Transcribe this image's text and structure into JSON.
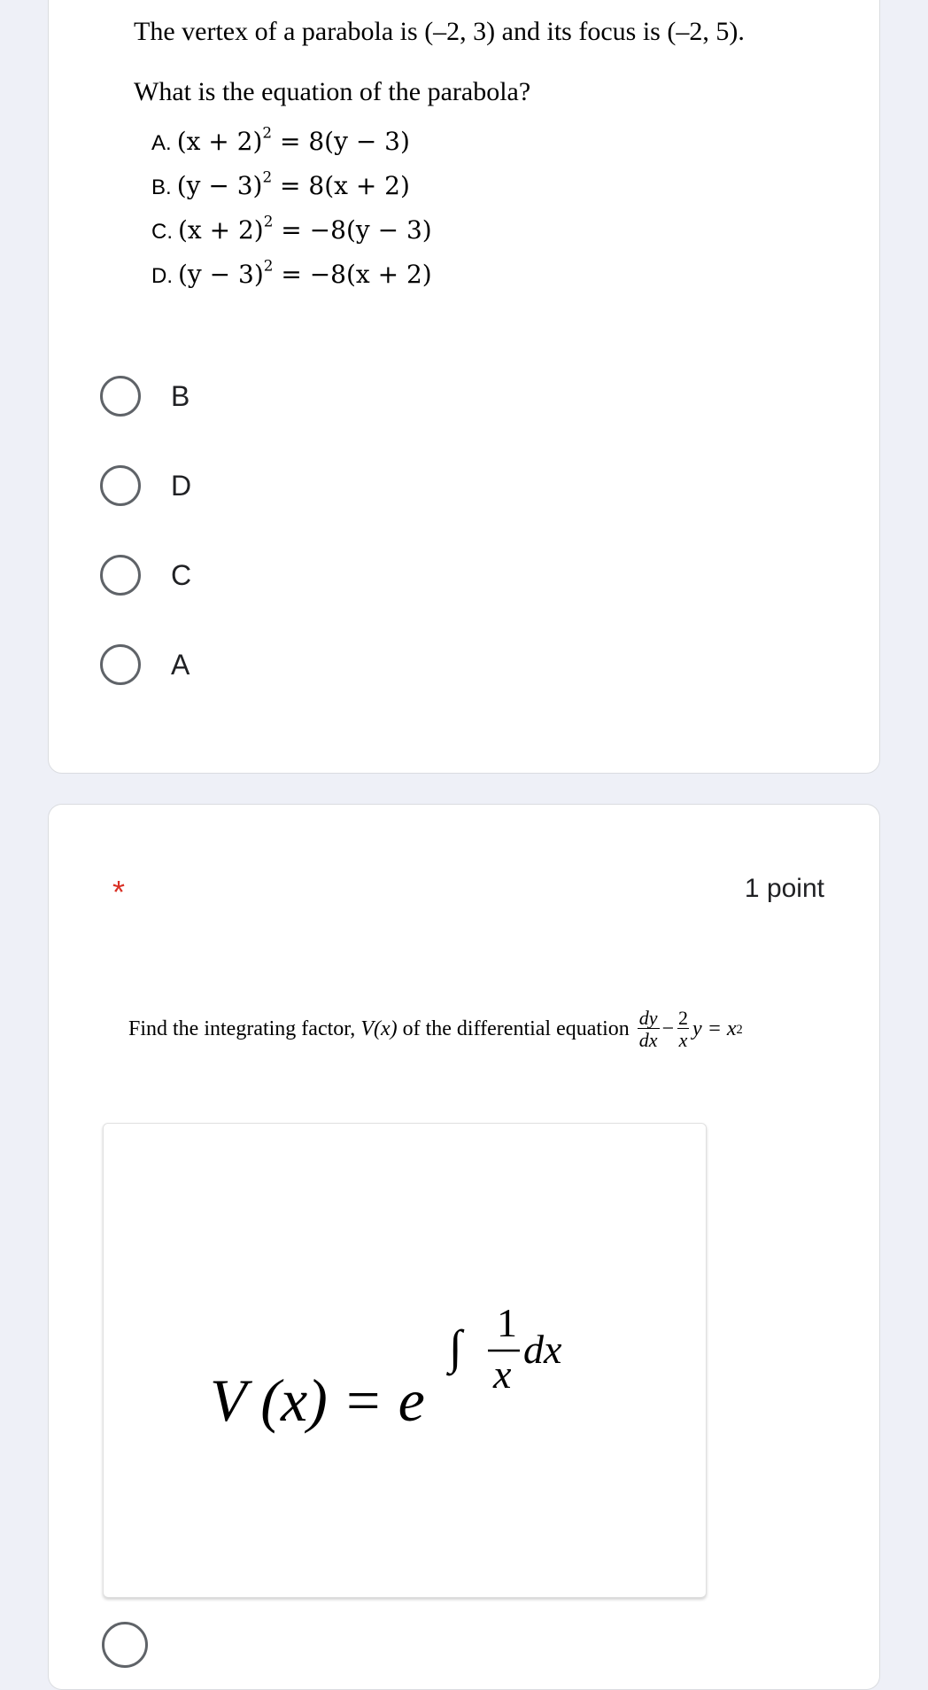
{
  "question1": {
    "line1_prefix": "The vertex of a parabola is",
    "vertex": "(–2, 3)",
    "line1_middle": "and its focus is",
    "focus": "(–2, 5)",
    "line1_suffix": ".",
    "line2": "What is the equation of the parabola?",
    "statement_options": [
      {
        "letter": "A.",
        "lhs_base": "(x + 2)",
        "rhs": " = 8(y − 3)"
      },
      {
        "letter": "B.",
        "lhs_base": "(y − 3)",
        "rhs": " = 8(x + 2)"
      },
      {
        "letter": "C.",
        "lhs_base": "(x + 2)",
        "rhs": " = −8(y − 3)"
      },
      {
        "letter": "D.",
        "lhs_base": "(y − 3)",
        "rhs": " = −8(x + 2)"
      }
    ],
    "exponent": "2",
    "choices": [
      "B",
      "D",
      "C",
      "A"
    ]
  },
  "question2": {
    "required_marker": "*",
    "points": "1 point",
    "text_prefix": "Find the integrating factor,",
    "func": "V(x)",
    "text_middle": "of the differential equation",
    "dy": "dy",
    "dx": "dx",
    "two": "2",
    "x": "x",
    "minus": "−",
    "eq_tail": "y = x",
    "eq_exp": "2",
    "formula_lhs": "V (x) = e",
    "formula_integral": "∫",
    "formula_num": "1",
    "formula_den": "x",
    "formula_dx": "dx"
  },
  "colors": {
    "background": "#eef0f7",
    "card": "#ffffff",
    "radio_border": "#5f6368",
    "required": "#d93025"
  }
}
